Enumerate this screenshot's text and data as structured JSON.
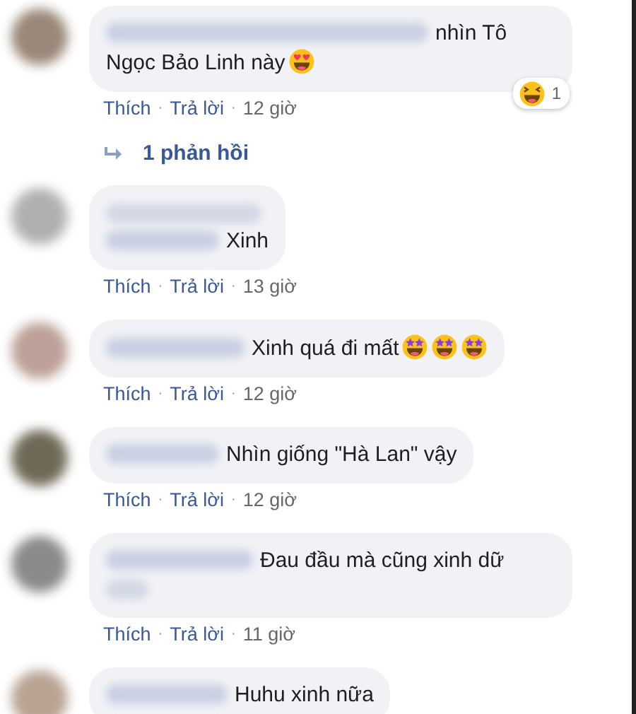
{
  "comments": [
    {
      "kind": "inline_wrap",
      "lines": [
        "nhìn Tô",
        "Ngọc Bảo Linh này"
      ],
      "emojis": [
        {
          "kind": "heart_eyes"
        }
      ],
      "reaction": {
        "kind": "laugh",
        "count": "1"
      },
      "meta": [
        {
          "kind": "link",
          "text": "Thích"
        },
        {
          "kind": "sep",
          "text": "·"
        },
        {
          "kind": "link",
          "text": "Trả lời"
        },
        {
          "kind": "sep",
          "text": "·"
        },
        {
          "kind": "time",
          "text": "12 giờ"
        }
      ],
      "replies": "1 phản hồi"
    },
    {
      "kind": "stacked",
      "lines": [
        "Xinh"
      ],
      "meta": [
        {
          "kind": "link",
          "text": "Thích"
        },
        {
          "kind": "sep",
          "text": "·"
        },
        {
          "kind": "link",
          "text": "Trả lời"
        },
        {
          "kind": "sep",
          "text": "·"
        },
        {
          "kind": "time",
          "text": "13 giờ"
        }
      ]
    },
    {
      "kind": "inline",
      "lines": [
        "Xinh quá đi mất"
      ],
      "emojis": [
        {
          "kind": "star_eyes"
        },
        {
          "kind": "star_eyes"
        },
        {
          "kind": "star_eyes"
        }
      ],
      "meta": [
        {
          "kind": "link",
          "text": "Thích"
        },
        {
          "kind": "sep",
          "text": "·"
        },
        {
          "kind": "link",
          "text": "Trả lời"
        },
        {
          "kind": "sep",
          "text": "·"
        },
        {
          "kind": "time",
          "text": "12 giờ"
        }
      ]
    },
    {
      "kind": "inline",
      "lines": [
        "Nhìn giống \"Hà Lan\" vậy"
      ],
      "meta": [
        {
          "kind": "link",
          "text": "Thích"
        },
        {
          "kind": "sep",
          "text": "·"
        },
        {
          "kind": "link",
          "text": "Trả lời"
        },
        {
          "kind": "sep",
          "text": "·"
        },
        {
          "kind": "time",
          "text": "12 giờ"
        }
      ]
    },
    {
      "kind": "inline_tail",
      "lines": [
        "Đau đầu mà cũng xinh dữ"
      ],
      "meta": [
        {
          "kind": "link",
          "text": "Thích"
        },
        {
          "kind": "sep",
          "text": "·"
        },
        {
          "kind": "link",
          "text": "Trả lời"
        },
        {
          "kind": "sep",
          "text": "·"
        },
        {
          "kind": "time",
          "text": "11 giờ"
        }
      ]
    },
    {
      "kind": "inline",
      "lines": [
        "Huhu xinh nữa"
      ]
    }
  ]
}
